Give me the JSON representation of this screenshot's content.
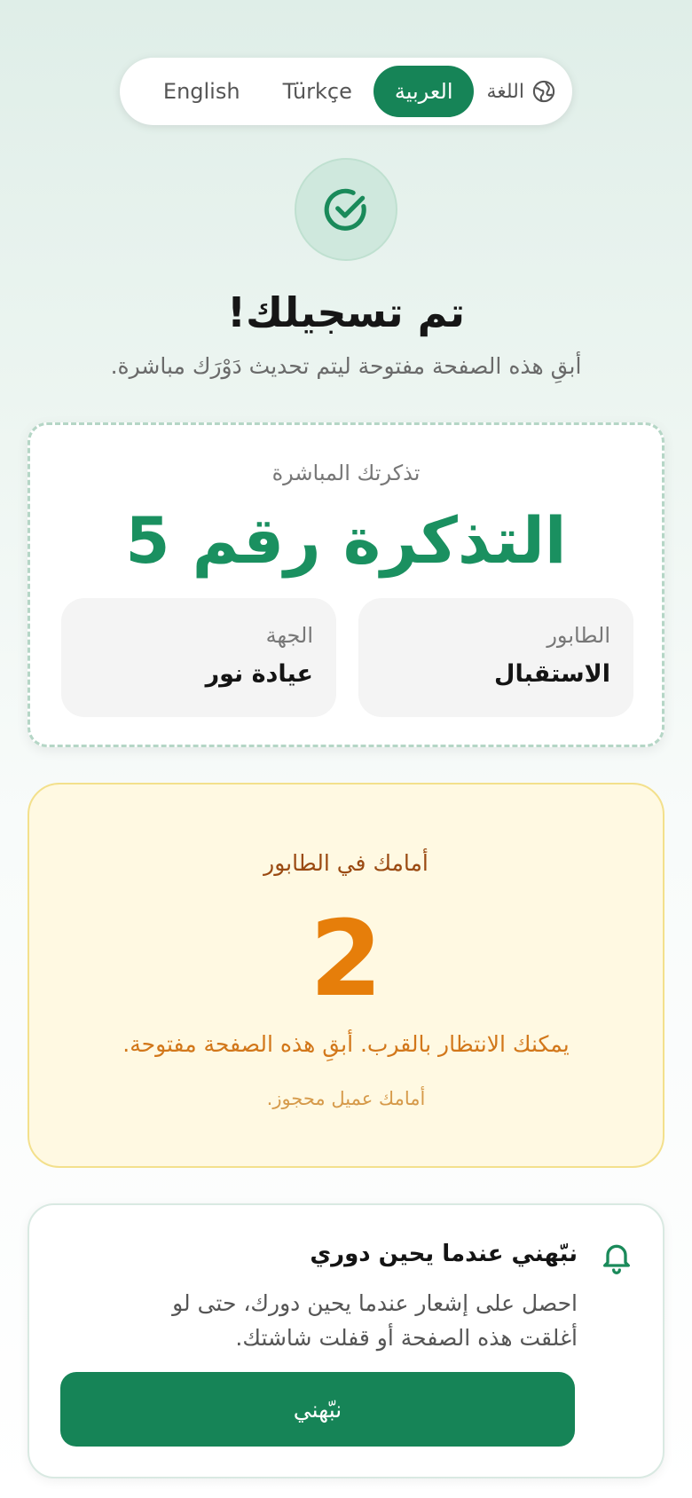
{
  "language": {
    "label": "اللغة",
    "options": [
      "العربية",
      "Türkçe",
      "English"
    ],
    "selected": "العربية"
  },
  "status": {
    "title": "تم تسجيلك!",
    "subtitle": "أبقِ هذه الصفحة مفتوحة ليتم تحديث دَوْرَك مباشرة."
  },
  "ticket": {
    "label": "تذكرتك المباشرة",
    "number_text": "التذكرة رقم 5",
    "queue_label": "الطابور",
    "queue_value": "الاستقبال",
    "department_label": "الجهة",
    "department_value": "عيادة نور"
  },
  "ahead": {
    "label": "أمامك في الطابور",
    "count": "2",
    "hint": "يمكنك الانتظار بالقرب. أبقِ هذه الصفحة مفتوحة.",
    "note": "أمامك عميل محجوز."
  },
  "notify": {
    "title": "نبّهني عندما يحين دوري",
    "description": "احصل على إشعار عندما يحين دورك، حتى لو أغلقت هذه الصفحة أو قفلت شاشتك.",
    "button_label": "نبّهني"
  },
  "colors": {
    "primary": "#168457",
    "ticket_number": "#1a9060",
    "ahead_count": "#e67e0a",
    "ahead_bg": "#fff9e2"
  }
}
